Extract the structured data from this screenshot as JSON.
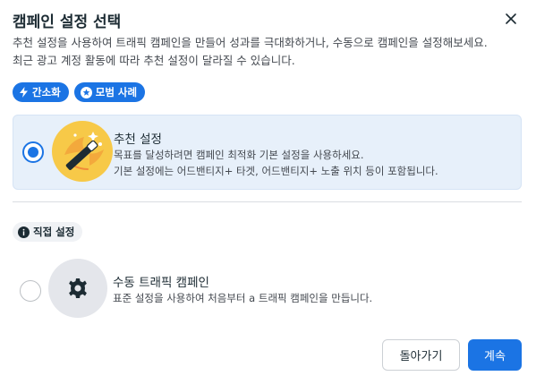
{
  "dialog": {
    "title": "캠페인 설정 선택",
    "description": "추천 설정을 사용하여 트래픽 캠페인을 만들어 성과를 극대화하거나, 수동으로 캠페인을 설정해보세요. 최근 광고 계정 활동에 따라 추천 설정이 달라질 수 있습니다."
  },
  "badges": [
    {
      "label": "간소화",
      "icon": "lightning-icon"
    },
    {
      "label": "모범 사례",
      "icon": "star-icon"
    }
  ],
  "recommended": {
    "title": "추천 설정",
    "line1": "목표를 달성하려면 캠페인 최적화 기본 설정을 사용하세요.",
    "line2": "기본 설정에는 어드밴티지+ 타겟, 어드밴티지+ 노출 위치 등이 포함됩니다.",
    "selected": true,
    "icon": "magic-wand-icon"
  },
  "manual": {
    "pill_label": "직접 설정",
    "pill_icon": "info-icon",
    "title": "수동 트래픽 캠페인",
    "description": "표준 설정을 사용하여 처음부터 a 트래픽 캠페인을 만듭니다.",
    "selected": false,
    "icon": "gear-icon"
  },
  "footer": {
    "back_label": "돌아가기",
    "continue_label": "계속"
  },
  "colors": {
    "accent": "#1b74e4",
    "card_bg": "#e7f0fa",
    "illustration_bg": "#f7c948"
  }
}
